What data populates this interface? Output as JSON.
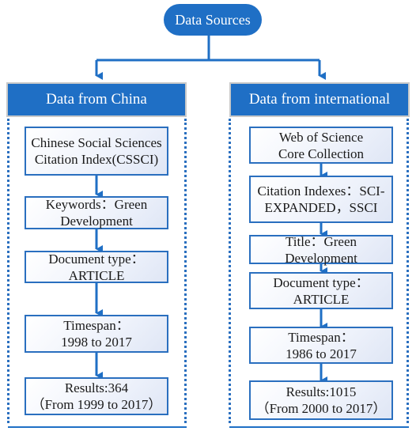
{
  "root": {
    "label": "Data Sources"
  },
  "colors": {
    "accent": "#1f6fc5",
    "box_border": "#2a6fbf",
    "header_text": "#ffffff"
  },
  "left": {
    "header": "Data from China",
    "steps": [
      {
        "line1": "Chinese Social Sciences",
        "line2": "Citation Index(CSSCI)"
      },
      {
        "line1": "Keywords：Green",
        "line2": "Development"
      },
      {
        "line1": "Document type：",
        "line2": "ARTICLE"
      },
      {
        "line1": "Timespan：",
        "line2": "1998 to 2017"
      },
      {
        "line1": "Results:364",
        "line2": "（From 1999 to 2017）"
      }
    ]
  },
  "right": {
    "header": "Data from international",
    "steps": [
      {
        "line1": "Web of Science",
        "line2": "Core Collection"
      },
      {
        "line1": "Citation Indexes：SCI-",
        "line2": "EXPANDED，SSCI"
      },
      {
        "line1": "Title：Green",
        "line2": "Development"
      },
      {
        "line1": "Document type：",
        "line2": "ARTICLE"
      },
      {
        "line1": "Timespan：",
        "line2": "1986 to 2017"
      },
      {
        "line1": "Results:1015",
        "line2": "（From 2000 to 2017）"
      }
    ]
  }
}
